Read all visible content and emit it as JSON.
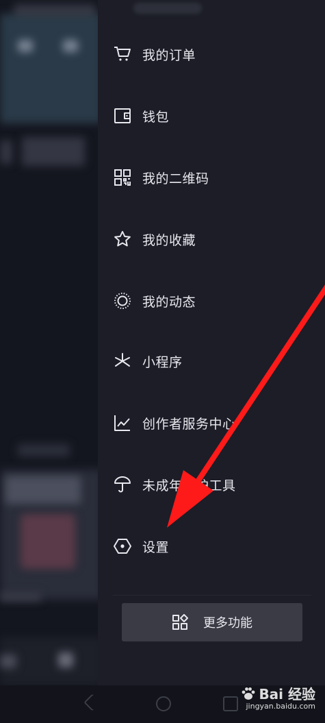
{
  "menu": {
    "items": [
      {
        "label": "我的订单",
        "icon": "shopping-cart-icon"
      },
      {
        "label": "钱包",
        "icon": "wallet-icon"
      },
      {
        "label": "我的二维码",
        "icon": "qr-code-icon"
      },
      {
        "label": "我的收藏",
        "icon": "star-icon"
      },
      {
        "label": "我的动态",
        "icon": "dynamic-circle-icon"
      },
      {
        "label": "小程序",
        "icon": "mini-program-icon"
      },
      {
        "label": "创作者服务中心",
        "icon": "chart-line-icon"
      },
      {
        "label": "未成年保护工具",
        "icon": "umbrella-icon"
      },
      {
        "label": "设置",
        "icon": "settings-hexagon-icon"
      }
    ],
    "more_button": {
      "label": "更多功能",
      "icon": "grid-apps-icon"
    }
  },
  "watermark": {
    "brand": "Bai 经验",
    "url": "jingyan.baidu.com"
  },
  "colors": {
    "drawer_bg": "#1c1d27",
    "text": "#e8e9ee",
    "button_bg": "#3a3b45",
    "arrow": "#ff1a1a"
  }
}
